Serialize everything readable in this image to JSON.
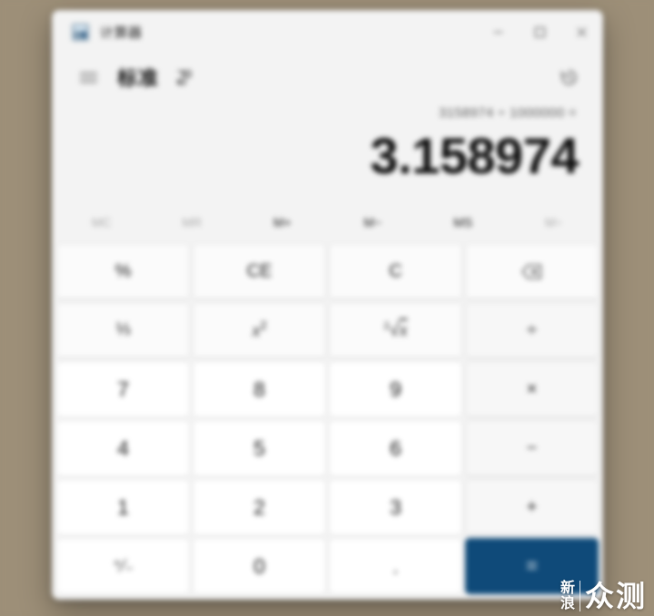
{
  "window": {
    "app_icon": "calculator-icon",
    "title": "计算器",
    "controls": {
      "minimize": "minimize-icon",
      "maximize": "maximize-icon",
      "close": "close-icon"
    }
  },
  "header": {
    "menu_icon": "hamburger-menu-icon",
    "mode": "标准",
    "keep_on_top_icon": "keep-on-top-icon",
    "history_icon": "history-icon"
  },
  "display": {
    "expression": "3158974 ÷ 1000000 =",
    "result": "3.158974"
  },
  "memory": {
    "buttons": [
      {
        "label": "MC",
        "enabled": false
      },
      {
        "label": "MR",
        "enabled": false
      },
      {
        "label": "M+",
        "enabled": true
      },
      {
        "label": "M−",
        "enabled": true
      },
      {
        "label": "MS",
        "enabled": true
      },
      {
        "label": "M",
        "enabled": false,
        "chevron": "˅"
      }
    ]
  },
  "keypad": {
    "rows": [
      [
        {
          "name": "percent",
          "label": "%",
          "type": "func"
        },
        {
          "name": "clear-entry",
          "label": "CE",
          "type": "func"
        },
        {
          "name": "clear",
          "label": "C",
          "type": "func"
        },
        {
          "name": "backspace",
          "label": "",
          "type": "func",
          "icon": "backspace-icon"
        }
      ],
      [
        {
          "name": "reciprocal",
          "label": "1/x",
          "type": "func"
        },
        {
          "name": "square",
          "label": "x2",
          "type": "func"
        },
        {
          "name": "square-root",
          "label": "2√x",
          "type": "func"
        },
        {
          "name": "divide",
          "label": "÷",
          "type": "op"
        }
      ],
      [
        {
          "name": "seven",
          "label": "7",
          "type": "digit"
        },
        {
          "name": "eight",
          "label": "8",
          "type": "digit"
        },
        {
          "name": "nine",
          "label": "9",
          "type": "digit"
        },
        {
          "name": "multiply",
          "label": "×",
          "type": "op"
        }
      ],
      [
        {
          "name": "four",
          "label": "4",
          "type": "digit"
        },
        {
          "name": "five",
          "label": "5",
          "type": "digit"
        },
        {
          "name": "six",
          "label": "6",
          "type": "digit"
        },
        {
          "name": "subtract",
          "label": "−",
          "type": "op"
        }
      ],
      [
        {
          "name": "one",
          "label": "1",
          "type": "digit"
        },
        {
          "name": "two",
          "label": "2",
          "type": "digit"
        },
        {
          "name": "three",
          "label": "3",
          "type": "digit"
        },
        {
          "name": "add",
          "label": "+",
          "type": "op"
        }
      ],
      [
        {
          "name": "negate",
          "label": "+/−",
          "type": "digit"
        },
        {
          "name": "zero",
          "label": "0",
          "type": "digit"
        },
        {
          "name": "decimal",
          "label": ".",
          "type": "digit"
        },
        {
          "name": "equals",
          "label": "=",
          "type": "equals"
        }
      ]
    ]
  },
  "watermark": {
    "brand_line1": "新",
    "brand_line2": "浪",
    "brand_main": "众测"
  },
  "colors": {
    "accent": "#0f4a79",
    "window_bg": "#f3f3f3",
    "digit_key": "#ffffff",
    "func_key": "#fbfbfb",
    "op_key": "#f7f7f7",
    "text": "#1b1b1b",
    "muted_text": "#a9a9a9"
  }
}
